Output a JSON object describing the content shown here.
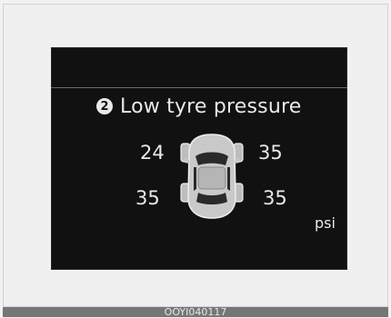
{
  "warning": {
    "badge_number": "2",
    "title": "Low tyre pressure"
  },
  "tyres": {
    "front_left": "24",
    "front_right": "35",
    "rear_left": "35",
    "rear_right": "35"
  },
  "unit": "psi",
  "caption": "OOYI040117",
  "colors": {
    "screen_background": "#111111",
    "text": "#e9e9e9",
    "caption_bar": "#767676"
  },
  "icons": {
    "badge": "circled-number-2",
    "car": "car-top-view-icon"
  }
}
